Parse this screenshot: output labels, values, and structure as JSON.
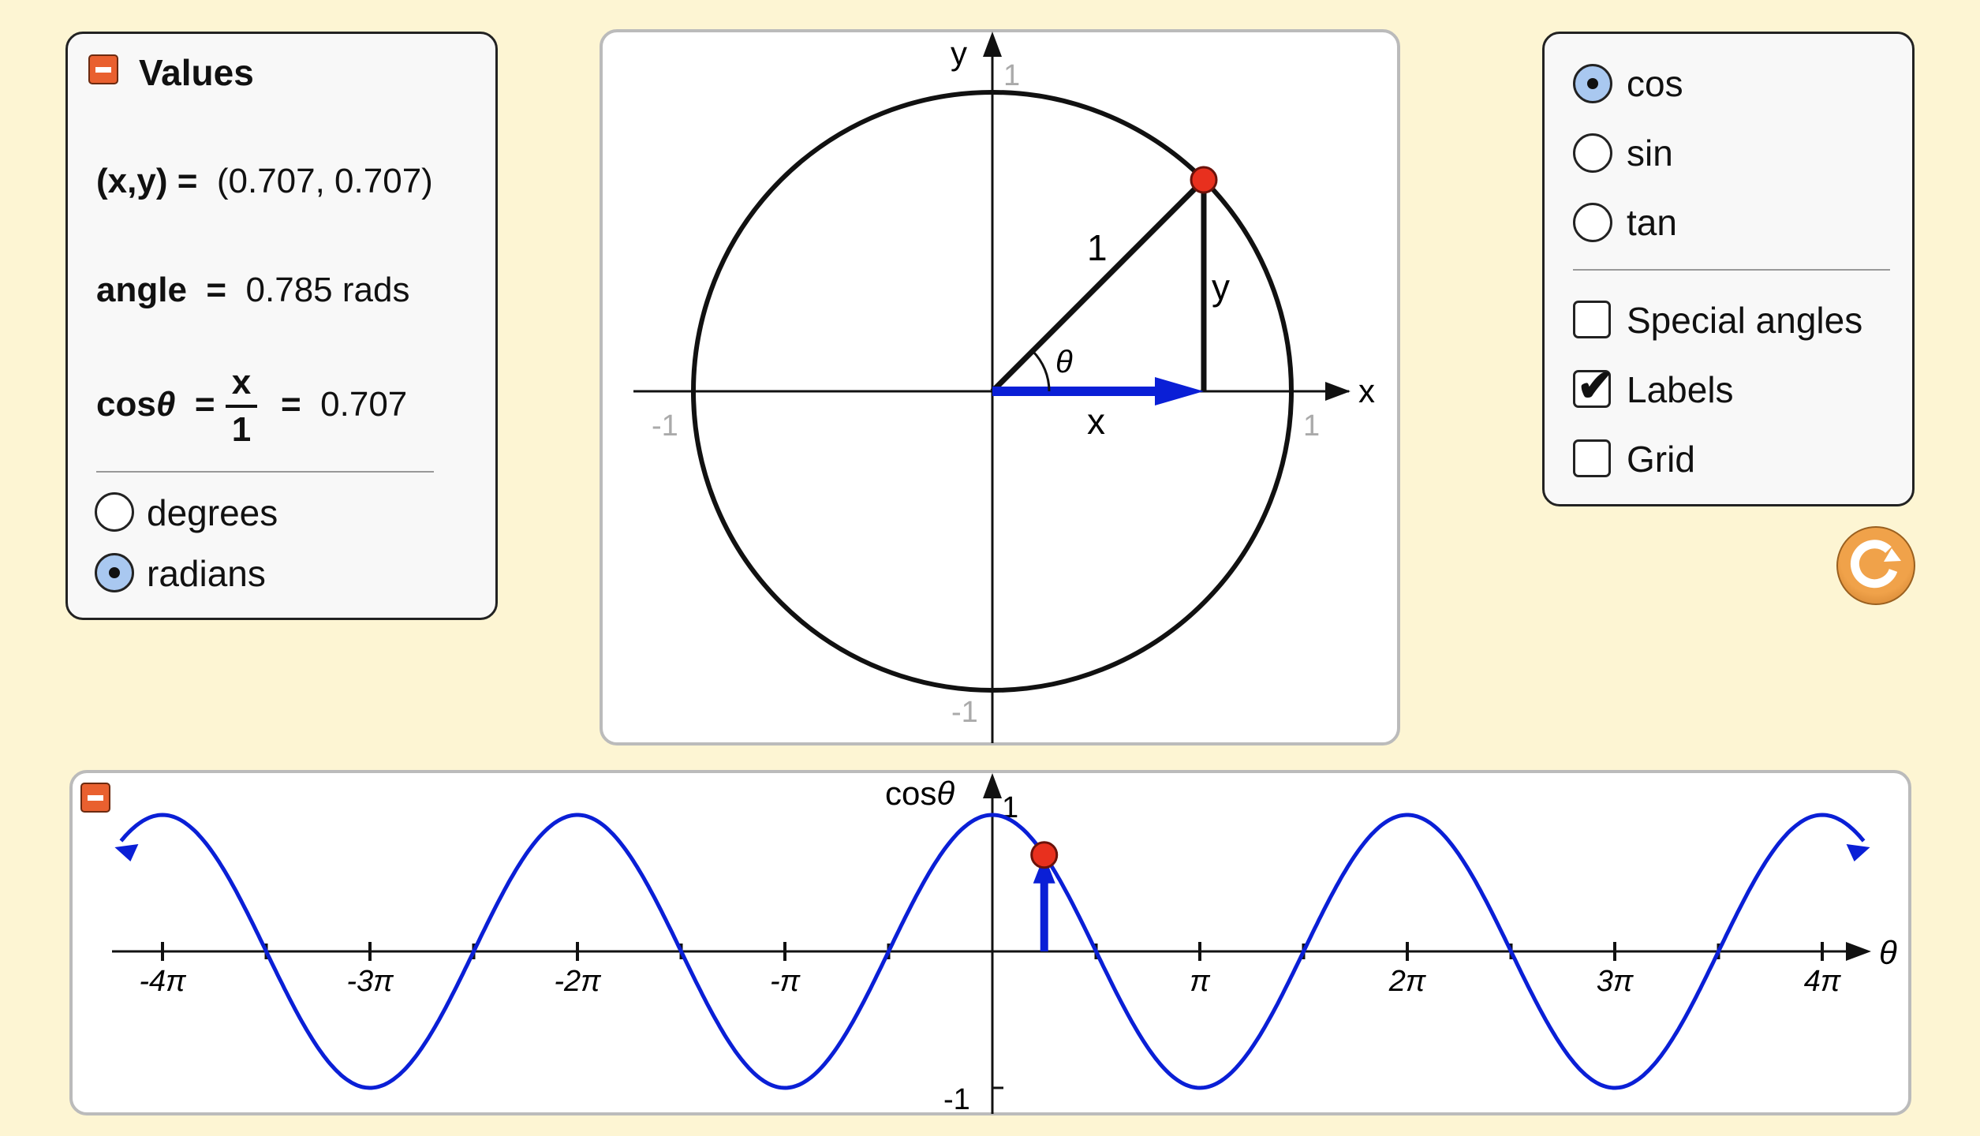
{
  "values_panel": {
    "title": "Values",
    "xy_label": "(x,y) =",
    "xy_value": "(0.707, 0.707)",
    "angle_label": "angle",
    "angle_eq": "=",
    "angle_value": "0.785 rads",
    "cos_label": "cos",
    "theta": "θ",
    "eq": "=",
    "frac_num": "x",
    "frac_den": "1",
    "cos_value": "0.707",
    "units": [
      {
        "label": "degrees",
        "selected": false
      },
      {
        "label": "radians",
        "selected": true
      }
    ]
  },
  "unit_circle": {
    "x_axis": "x",
    "y_axis": "y",
    "tick_pos_x": "1",
    "tick_neg_x": "-1",
    "tick_pos_y": "1",
    "tick_neg_y": "-1",
    "hyp_label": "1",
    "opp_label": "y",
    "adj_label": "x",
    "angle_label": "θ",
    "angle_rad": 0.785,
    "colors": {
      "x_segment": "#0a1fd6",
      "point": "#e8301e"
    }
  },
  "options_panel": {
    "functions": [
      {
        "label": "cos",
        "selected": true
      },
      {
        "label": "sin",
        "selected": false
      },
      {
        "label": "tan",
        "selected": false
      }
    ],
    "checkboxes": [
      {
        "label": "Special angles",
        "checked": false
      },
      {
        "label": "Labels",
        "checked": true
      },
      {
        "label": "Grid",
        "checked": false
      }
    ]
  },
  "reset_button": {
    "icon": "reset-icon",
    "color": "#ea9a3f"
  },
  "chart_data": {
    "type": "line",
    "function": "cos",
    "ylabel": "cosθ",
    "xlabel": "θ",
    "xlim": [
      -4.2,
      4.2
    ],
    "xlim_units": "π",
    "ylim": [
      -1,
      1
    ],
    "x_ticks": [
      "-4π",
      "-3π",
      "-2π",
      "-π",
      "π",
      "2π",
      "3π",
      "4π"
    ],
    "y_ticks": [
      "1",
      "-1"
    ],
    "current_point": {
      "x": 0.785,
      "y": 0.707
    },
    "grid": false,
    "colors": {
      "curve": "#0a1fd6",
      "point": "#e8301e"
    }
  }
}
